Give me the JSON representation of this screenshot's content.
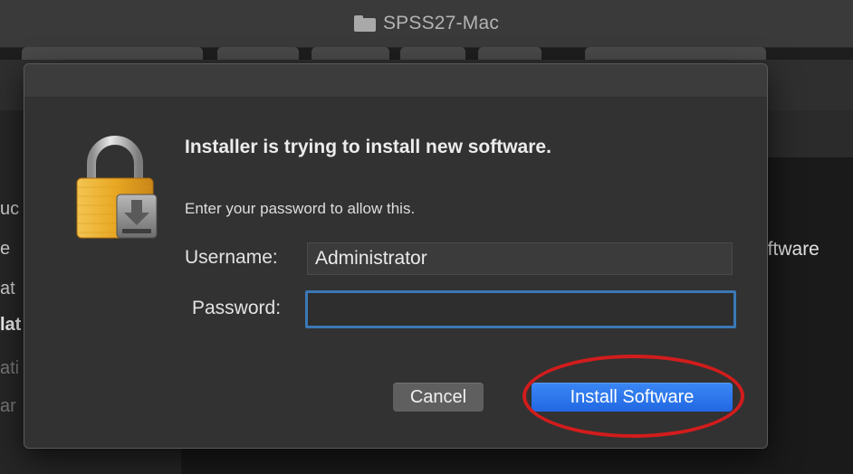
{
  "window": {
    "title": "SPSS27-Mac",
    "folder_icon": "folder-icon"
  },
  "background": {
    "sidebar_fragments": [
      "uc",
      "e",
      "at",
      "lat",
      "ati",
      "ar"
    ],
    "right_fragment": "oftware"
  },
  "dialog": {
    "icon": "lock-icon",
    "heading": "Installer is trying to install new software.",
    "message": "Enter your password to allow this.",
    "username_label": "Username:",
    "username_value": "Administrator",
    "password_label": "Password:",
    "password_value": "",
    "cancel_label": "Cancel",
    "install_label": "Install Software",
    "accent_color": "#2b72e8",
    "highlight_color": "#d21c1c"
  }
}
